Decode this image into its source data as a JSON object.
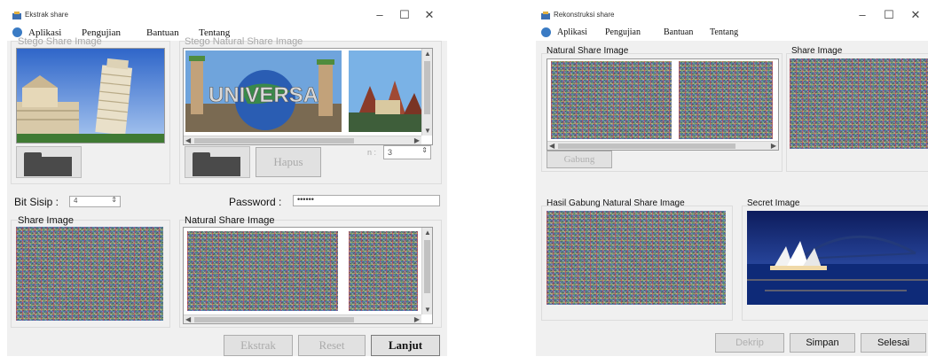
{
  "left_window": {
    "title": "Ekstrak share",
    "controls": {
      "minimize": "–",
      "maximize": "☐",
      "close": "✕"
    },
    "menu": [
      "Aplikasi",
      "Pengujian",
      "Bantuan",
      "Tentang"
    ],
    "stego_share_label": "Stego Share Image",
    "stego_natural_label": "Stego Natural  Share Image",
    "hapus_button": "Hapus",
    "n_label": "n :",
    "n_value": "3",
    "bit_sisip_label": "Bit Sisip :",
    "bit_sisip_value": "4",
    "password_label": "Password :",
    "password_value": "••••••",
    "share_image_label": "Share Image",
    "natural_share_label": "Natural Share Image",
    "ekstrak_button": "Ekstrak",
    "reset_button": "Reset",
    "lanjut_button": "Lanjut",
    "universal_text": "UNIVERSA"
  },
  "right_window": {
    "title": "Rekonstruksi share",
    "controls": {
      "minimize": "–",
      "maximize": "☐",
      "close": "✕"
    },
    "menu": [
      "Aplikasi",
      "Pengujian",
      "Bantuan",
      "Tentang"
    ],
    "natural_share_label": "Natural Share Image",
    "share_image_label": "Share Image",
    "gabung_button": "Gabung",
    "hasil_label": "Hasil Gabung Natural Share Image",
    "secret_label": "Secret Image",
    "dekrip_button": "Dekrip",
    "simpan_button": "Simpan",
    "selesai_button": "Selesai"
  },
  "colors": {
    "window_bg": "#f0f0f0",
    "disabled_text": "#aaaaaa",
    "menu_icon": "#3a7bc4"
  }
}
